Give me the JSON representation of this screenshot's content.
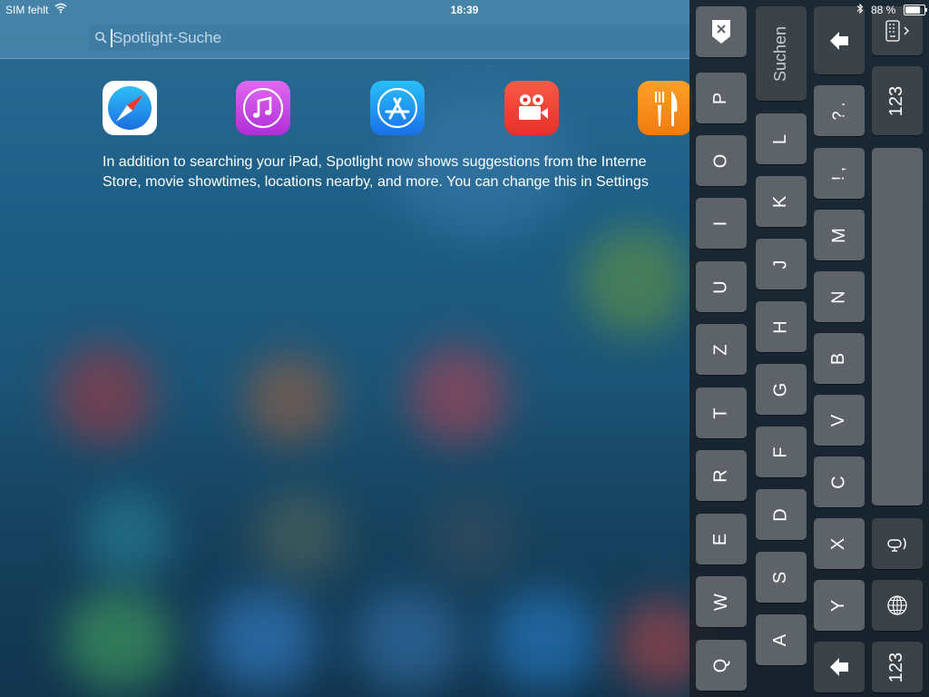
{
  "status_bar": {
    "carrier": "SIM fehlt",
    "time": "18:39",
    "battery_percent": "88 %",
    "battery_level": 0.88
  },
  "search": {
    "placeholder": "Spotlight-Suche",
    "value": ""
  },
  "suggested_apps": [
    {
      "name": "safari",
      "icon": "safari-icon",
      "color": "#1f8ef0"
    },
    {
      "name": "itunes-store",
      "icon": "music-note-icon",
      "color": "#c23ee0"
    },
    {
      "name": "app-store",
      "icon": "app-store-icon",
      "color": "#1a8df0"
    },
    {
      "name": "videos",
      "icon": "video-camera-icon",
      "color": "#f23a30"
    },
    {
      "name": "restaurants",
      "icon": "fork-knife-icon",
      "color": "#f68a1c"
    }
  ],
  "suggestion_text": {
    "line1": "In addition to searching your iPad, Spotlight now shows suggestions from the Interne",
    "line2": "Store, movie showtimes, locations nearby, and more. You can change this in Settings"
  },
  "keyboard": {
    "row_letters_1": [
      "Q",
      "W",
      "E",
      "R",
      "T",
      "Z",
      "U",
      "I",
      "O",
      "P"
    ],
    "row_letters_2": [
      "A",
      "S",
      "D",
      "F",
      "G",
      "H",
      "J",
      "K",
      "L"
    ],
    "row_letters_3": [
      "Y",
      "X",
      "C",
      "V",
      "B",
      "N",
      "M"
    ],
    "punct_1": "! ,",
    "punct_2": "? .",
    "search_key": "Suchen",
    "num_key_top": "123",
    "num_key_bottom": "123"
  },
  "colors": {
    "key": "#5d6369",
    "key_dark": "#3b4248",
    "panel": "#191f27"
  }
}
